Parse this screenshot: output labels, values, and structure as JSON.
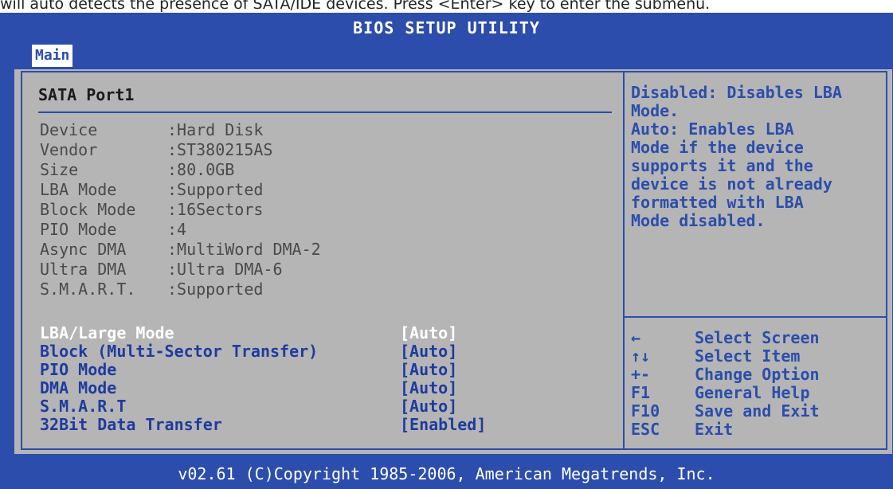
{
  "doc_line": "will auto detects the presence of SATA/IDE devices. Press <Enter> key to enter the submenu.",
  "window_title": "BIOS SETUP UTILITY",
  "tabs": [
    {
      "label": "Main"
    }
  ],
  "panel": {
    "title": "SATA Port1",
    "info": [
      {
        "key": "Device",
        "value": ":Hard Disk"
      },
      {
        "key": "Vendor",
        "value": ":ST380215AS"
      },
      {
        "key": "Size",
        "value": ":80.0GB"
      },
      {
        "key": "LBA Mode",
        "value": ":Supported"
      },
      {
        "key": "Block Mode",
        "value": ":16Sectors"
      },
      {
        "key": "PIO Mode",
        "value": ":4"
      },
      {
        "key": "Async DMA",
        "value": ":MultiWord DMA-2"
      },
      {
        "key": "Ultra DMA",
        "value": ":Ultra DMA-6"
      },
      {
        "key": "S.M.A.R.T.",
        "value": ":Supported"
      }
    ],
    "options": [
      {
        "label": "LBA/Large Mode",
        "value": "[Auto]"
      },
      {
        "label": "Block (Multi-Sector Transfer)",
        "value": "[Auto]"
      },
      {
        "label": "PIO Mode",
        "value": "[Auto]"
      },
      {
        "label": "DMA Mode",
        "value": "[Auto]"
      },
      {
        "label": "S.M.A.R.T",
        "value": "[Auto]"
      },
      {
        "label": "32Bit Data Transfer",
        "value": "[Enabled]"
      }
    ],
    "selected_option": "LBA/Large Mode"
  },
  "help": {
    "lines": [
      "Disabled: Disables LBA",
      "Mode.",
      "Auto: Enables LBA",
      "Mode if the device",
      "supports it and the",
      "device is not already",
      "formatted with LBA",
      "Mode disabled."
    ]
  },
  "keys": [
    {
      "key": "←",
      "action": "Select Screen"
    },
    {
      "key": "↑↓",
      "action": "Select Item"
    },
    {
      "key": "+-",
      "action": "Change Option"
    },
    {
      "key": "F1",
      "action": "General Help"
    },
    {
      "key": "F10",
      "action": "Save and Exit"
    },
    {
      "key": "ESC",
      "action": "Exit"
    }
  ],
  "footer": "v02.61 (C)Copyright 1985-2006, American Megatrends, Inc.",
  "colors": {
    "background_blue": "#2c4dab",
    "panel_gray": "#b5b5b5",
    "text_white": "#ffffff",
    "info_text": "#4a4a4a"
  }
}
